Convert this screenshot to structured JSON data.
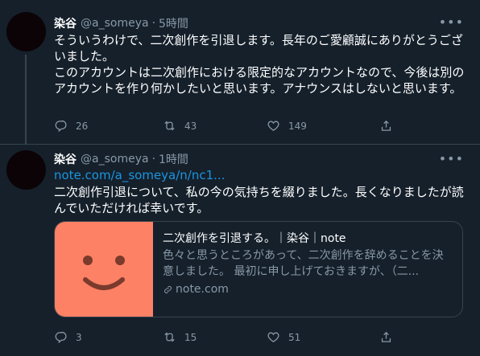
{
  "tweet1": {
    "name": "染谷",
    "handle": "@a_someya",
    "time": "5時間",
    "text_p1": "そういうわけで、二次創作を引退します。長年のご愛顧誠にありがとうございました。",
    "text_p2": "このアカウントは二次創作における限定的なアカウントなので、今後は別のアカウントを作り何かしたいと思います。アナウンスはしないと思います。",
    "replies": "26",
    "retweets": "43",
    "likes": "149"
  },
  "tweet2": {
    "name": "染谷",
    "handle": "@a_someya",
    "time": "1時間",
    "link": "note.com/a_someya/n/nc1...",
    "text": "二次創作引退について、私の今の気持ちを綴りました。長くなりましたが読んでいただければ幸いです。",
    "card": {
      "title": "二次創作を引退する。｜染谷｜note",
      "description": "色々と思うところがあって、二次創作を辞めることを決意しました。 最初に申し上げておきますが、（二...",
      "domain": "note.com",
      "thumb_color": "#fd8165"
    },
    "replies": "3",
    "retweets": "15",
    "likes": "51"
  },
  "separator": "·",
  "more_label": "•••",
  "colors": {
    "background": "#15202b",
    "secondary_text": "#8899a6",
    "link": "#1b95e0",
    "border": "#38444d"
  }
}
